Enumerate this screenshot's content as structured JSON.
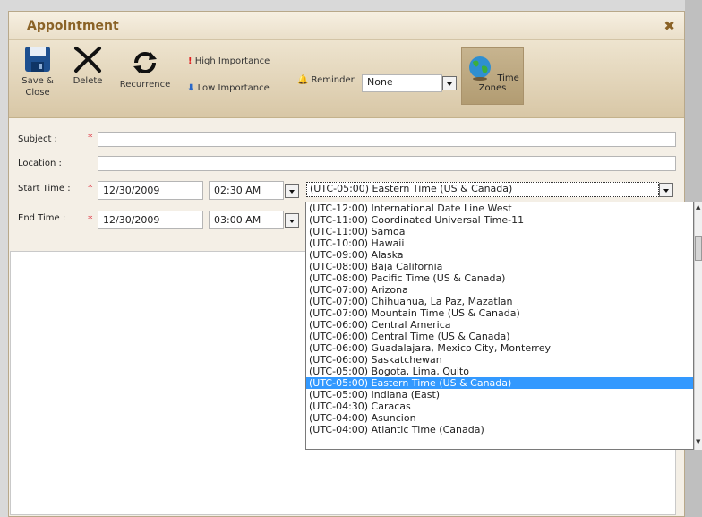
{
  "dialog": {
    "title": "Appointment",
    "close_glyph": "✖"
  },
  "ribbon": {
    "save_label_1": "Save &",
    "save_label_2": "Close",
    "delete_label": "Delete",
    "recurrence_label": "Recurrence",
    "high_importance": "High Importance",
    "low_importance": "Low Importance",
    "reminder_label": "Reminder",
    "reminder_value": "None",
    "time_zones_label": "Time Zones"
  },
  "form": {
    "subject_label": "Subject :",
    "location_label": "Location :",
    "start_label": "Start Time :",
    "end_label": "End Time :",
    "required_mark": "*",
    "start_date": "12/30/2009",
    "start_time": "02:30 AM",
    "end_date": "12/30/2009",
    "end_time": "03:00 AM",
    "timezone_value": "(UTC-05:00) Eastern Time (US & Canada)"
  },
  "timezones": [
    "(UTC-12:00) International Date Line West",
    "(UTC-11:00) Coordinated Universal Time-11",
    "(UTC-11:00) Samoa",
    "(UTC-10:00) Hawaii",
    "(UTC-09:00) Alaska",
    "(UTC-08:00) Baja California",
    "(UTC-08:00) Pacific Time (US & Canada)",
    "(UTC-07:00) Arizona",
    "(UTC-07:00) Chihuahua, La Paz, Mazatlan",
    "(UTC-07:00) Mountain Time (US & Canada)",
    "(UTC-06:00) Central America",
    "(UTC-06:00) Central Time (US & Canada)",
    "(UTC-06:00) Guadalajara, Mexico City, Monterrey",
    "(UTC-06:00) Saskatchewan",
    "(UTC-05:00) Bogota, Lima, Quito",
    "(UTC-05:00) Eastern Time (US & Canada)",
    "(UTC-05:00) Indiana (East)",
    "(UTC-04:30) Caracas",
    "(UTC-04:00) Asuncion",
    "(UTC-04:00) Atlantic Time (Canada)"
  ],
  "selected_timezone_index": 15,
  "colors": {
    "title": "#8a6226",
    "selection": "#3399ff",
    "required": "#dd2233"
  }
}
